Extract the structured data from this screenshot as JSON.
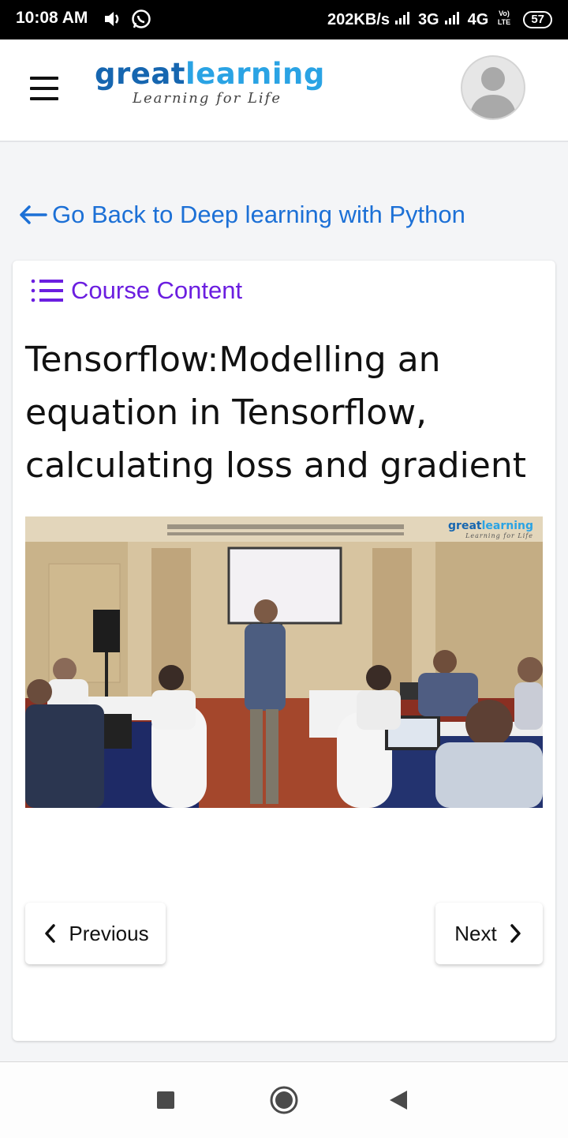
{
  "status_bar": {
    "time": "10:08 AM",
    "network_speed": "202KB/s",
    "network_3g": "3G",
    "network_4g": "4G",
    "volte": "VoLTE",
    "battery": "57",
    "icons": [
      "volume-icon",
      "whatsapp-icon",
      "signal-icon",
      "signal-icon",
      "battery-icon"
    ]
  },
  "header": {
    "logo_part1": "great",
    "logo_part2": "learning",
    "tagline": "Learning for Life",
    "colors": {
      "logo_dark": "#1666b0",
      "logo_light": "#2aa3e4"
    }
  },
  "back_link": {
    "label": "Go Back to Deep learning with Python",
    "color": "#1c70d6"
  },
  "course_content": {
    "label": "Course Content",
    "color": "#6b1ee0"
  },
  "lesson": {
    "title": "Tensorflow:Modelling an equation in Tensorflow, calculating loss and gradient"
  },
  "video": {
    "watermark_part1": "great",
    "watermark_part2": "learning",
    "watermark_tagline": "Learning for Life"
  },
  "pager": {
    "previous_label": "Previous",
    "next_label": "Next"
  },
  "nav_bar": {
    "icons": [
      "recents-square-icon",
      "home-circle-icon",
      "back-triangle-icon"
    ]
  }
}
